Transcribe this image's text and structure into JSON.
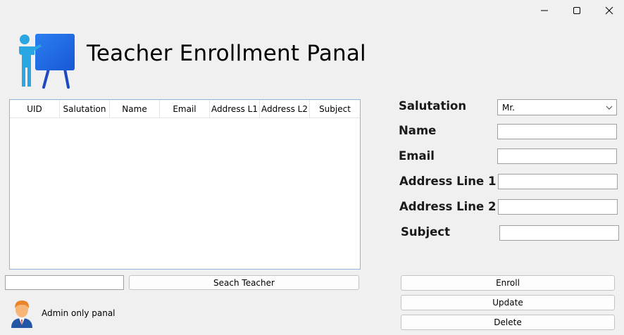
{
  "window": {
    "controls": {
      "minimize_icon": "minimize-icon",
      "maximize_icon": "maximize-icon",
      "close_icon": "close-icon"
    }
  },
  "header": {
    "title": "Teacher Enrollment Panal",
    "logo_icon": "teacher-presentation-icon",
    "logo_colors": {
      "board": "#1e6ee8",
      "person": "#27a3e0"
    }
  },
  "grid": {
    "columns": [
      "UID",
      "Salutation",
      "Name",
      "Email",
      "Address L1",
      "Address L2",
      "Subject"
    ],
    "rows": []
  },
  "form": {
    "salutation": {
      "label": "Salutation",
      "value": "Mr."
    },
    "name": {
      "label": "Name",
      "value": ""
    },
    "email": {
      "label": "Email",
      "value": ""
    },
    "address1": {
      "label": "Address Line 1",
      "value": ""
    },
    "address2": {
      "label": "Address Line 2",
      "value": ""
    },
    "subject": {
      "label": "Subject",
      "value": ""
    }
  },
  "search": {
    "value": "",
    "button_label": "Seach Teacher"
  },
  "actions": {
    "enroll": "Enroll",
    "update": "Update",
    "delete": "Delete"
  },
  "footer": {
    "admin_text": "Admin only panal",
    "avatar_icon": "admin-avatar-icon"
  }
}
